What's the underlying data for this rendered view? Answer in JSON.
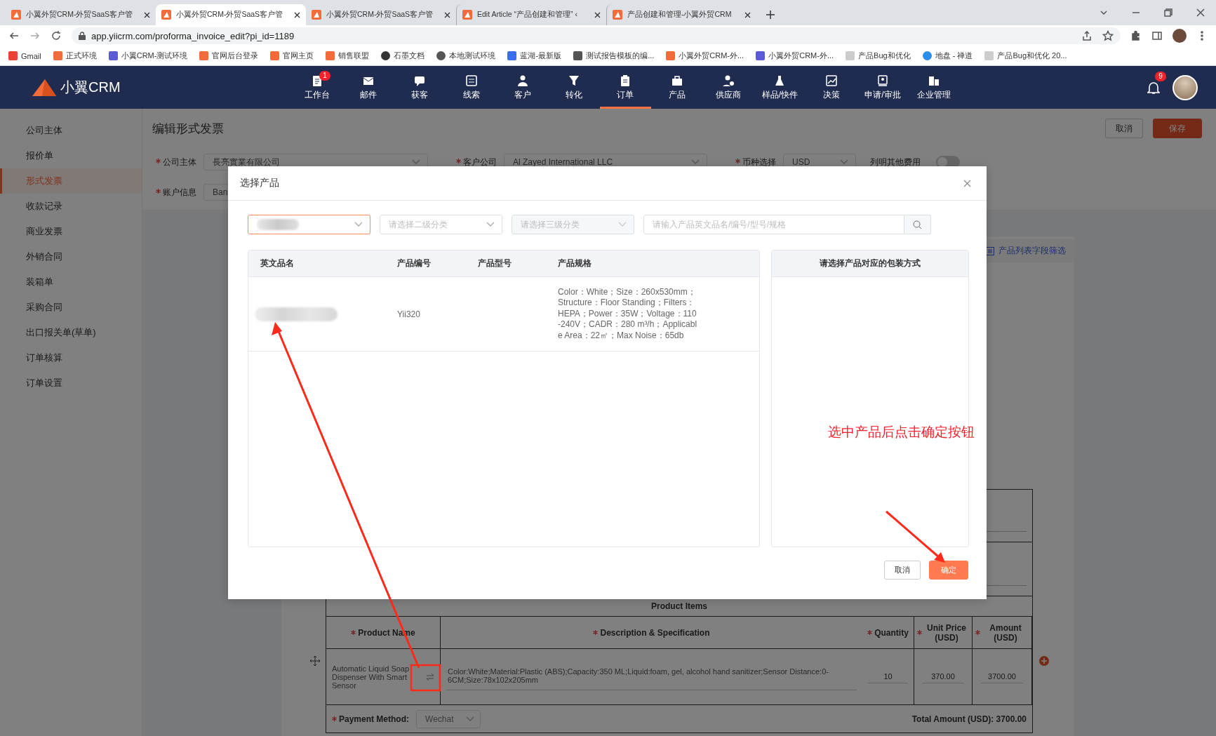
{
  "browser": {
    "tabs": [
      {
        "title": "小翼外贸CRM-外贸SaaS客户管",
        "selected": false
      },
      {
        "title": "小翼外贸CRM-外贸SaaS客户管",
        "selected": true
      },
      {
        "title": "小翼外贸CRM-外贸SaaS客户管",
        "selected": false
      },
      {
        "title": "Edit Article “产品创建和管理” ‹",
        "selected": false
      },
      {
        "title": "产品创建和管理-小翼外贸CRM",
        "selected": false
      }
    ],
    "address": "app.yiicrm.com/proforma_invoice_edit?pi_id=1189",
    "bookmarks": [
      "Gmail",
      "正式环境",
      "小翼CRM-测试环境",
      "官网后台登录",
      "官网主页",
      "销售联盟",
      "石墨文档",
      "本地测试环境",
      "蓝湖-最新版",
      "测试报告模板的编...",
      "小翼外贸CRM-外...",
      "小翼外贸CRM-外...",
      "产品Bug和优化",
      "地盘 - 禅道",
      "产品Bug和优化 20..."
    ]
  },
  "app": {
    "logo": "小翼CRM",
    "nav": [
      {
        "label": "工作台",
        "selected": false,
        "badge": "1"
      },
      {
        "label": "邮件",
        "selected": false
      },
      {
        "label": "获客",
        "selected": false
      },
      {
        "label": "线索",
        "selected": false
      },
      {
        "label": "客户",
        "selected": false
      },
      {
        "label": "转化",
        "selected": false
      },
      {
        "label": "订单",
        "selected": true
      },
      {
        "label": "产品",
        "selected": false
      },
      {
        "label": "供应商",
        "selected": false
      },
      {
        "label": "样品/快件",
        "selected": false
      },
      {
        "label": "决策",
        "selected": false
      },
      {
        "label": "申请/审批",
        "selected": false
      },
      {
        "label": "企业管理",
        "selected": false
      }
    ],
    "notification_badge": "9"
  },
  "sidebar": {
    "items": [
      {
        "label": "公司主体",
        "selected": false
      },
      {
        "label": "报价单",
        "selected": false
      },
      {
        "label": "形式发票",
        "selected": true
      },
      {
        "label": "收款记录",
        "selected": false
      },
      {
        "label": "商业发票",
        "selected": false
      },
      {
        "label": "外销合同",
        "selected": false
      },
      {
        "label": "装箱单",
        "selected": false
      },
      {
        "label": "采购合同",
        "selected": false
      },
      {
        "label": "出口报关单(草单)",
        "selected": false
      },
      {
        "label": "订单核算",
        "selected": false
      },
      {
        "label": "订单设置",
        "selected": false
      }
    ]
  },
  "form": {
    "title": "编辑形式发票",
    "buttons": [
      {
        "label": "取消",
        "kind": "default"
      },
      {
        "label": "保存",
        "kind": "primary"
      }
    ],
    "row_1": [
      {
        "label": "公司主体",
        "required": true,
        "value": "長亮實業有限公司"
      },
      {
        "label": "客户公司",
        "required": true,
        "value": "Al Zayed International LLC"
      },
      {
        "label": "币种选择",
        "required": true,
        "value": "USD"
      }
    ],
    "toggle": {
      "label": "列明其他费用",
      "on": false
    },
    "row_2": [
      {
        "label": "账户信息",
        "required": true,
        "value": "Ban"
      }
    ]
  },
  "product_filter_link": "产品列表字段筛选",
  "invoice": {
    "section_title": "Product Items",
    "columns": [
      {
        "label": "Product Name",
        "required": true
      },
      {
        "label": "Description & Specification",
        "required": true
      },
      {
        "label": "Quantity",
        "required": true
      },
      {
        "label": "Unit Price (USD)",
        "required": true
      },
      {
        "label": "Amount (USD)",
        "required": true
      }
    ],
    "rows": [
      {
        "product_name": "Automatic Liquid Soap Dispenser With Smart Sensor",
        "description": "Color:White;Material:Plastic (ABS);Capacity:350 ML;Liquid:foam, gel, alcohol hand sanitizer;Sensor Distance:0-6CM;Size:78x102x205mm",
        "quantity": "10",
        "unit_price": "370.00",
        "amount": "3700.00"
      }
    ],
    "payment_method": {
      "label": "Payment Method:",
      "required": true,
      "value": "Wechat"
    },
    "total": "Total Amount (USD): 3700.00"
  },
  "modal": {
    "title": "选择产品",
    "filters": [
      {
        "kind": "select",
        "redacted": true,
        "focused": true,
        "disabled": false
      },
      {
        "kind": "select",
        "placeholder": "请选择二级分类",
        "focused": false,
        "disabled": false
      },
      {
        "kind": "select",
        "placeholder": "请选择三级分类",
        "focused": false,
        "disabled": true
      },
      {
        "kind": "search",
        "placeholder": "请输入产品英文品名/编号/型号/规格"
      }
    ],
    "columns": [
      "英文品名",
      "产品编号",
      "产品型号",
      "产品规格"
    ],
    "rows": [
      {
        "name_redacted": true,
        "code": "Yii320",
        "spec": "Color：White；Size：260x530mm；Structure：Floor Standing；Filters：HEPA；Power：35W；Voltage：110-240V；CADR：280 m³/h；Applicable Area：22㎡；Max Noise：65db"
      }
    ],
    "packaging_header": "请选择产品对应的包装方式",
    "buttons": [
      {
        "label": "取消",
        "kind": "default"
      },
      {
        "label": "确定",
        "kind": "primary"
      }
    ]
  },
  "annotation": {
    "text": "选中产品后点击确定按钮"
  }
}
